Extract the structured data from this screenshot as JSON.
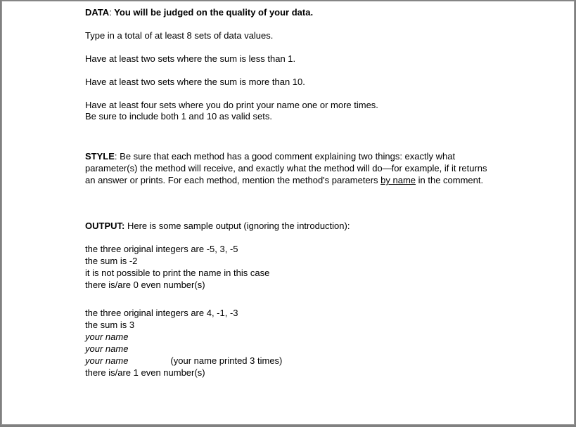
{
  "data_section": {
    "heading": "DATA",
    "heading_tail": ":",
    "subtitle": "  You will be judged on the quality of your data.",
    "lines": [
      "Type in a total of at least 8 sets of data values.",
      "Have at least two sets where the sum is less than 1.",
      "Have at least two sets where the sum is more than 10."
    ],
    "line4a": "Have at least four sets where you do print your name one or more times.",
    "line4b": "Be sure to include both 1 and 10 as valid sets."
  },
  "style_section": {
    "heading": "STYLE",
    "heading_tail": ":",
    "body_pre": "  Be sure that each method has a good comment explaining two things: exactly what parameter(s) the method will receive, and exactly what the method will do—for example, if it returns an answer or prints.  For each method, mention the method's parameters ",
    "underlined": "by name",
    "body_post": " in the comment."
  },
  "output_section": {
    "heading": "OUTPUT:",
    "intro": "  Here is some sample output (ignoring the introduction):",
    "sample1": {
      "line1": "the three original integers are  -5, 3, -5",
      "line2": "the sum is -2",
      "line3": "it is not possible to print the name in this case",
      "line4": "there is/are 0 even number(s)"
    },
    "sample2": {
      "line1": "the three original integers are  4, -1, -3",
      "line2": "the sum is 3",
      "name1": "your name",
      "name2": "your name",
      "name3": "your name",
      "note": "(your name printed 3 times)",
      "line_last": "there is/are 1 even number(s)"
    }
  }
}
